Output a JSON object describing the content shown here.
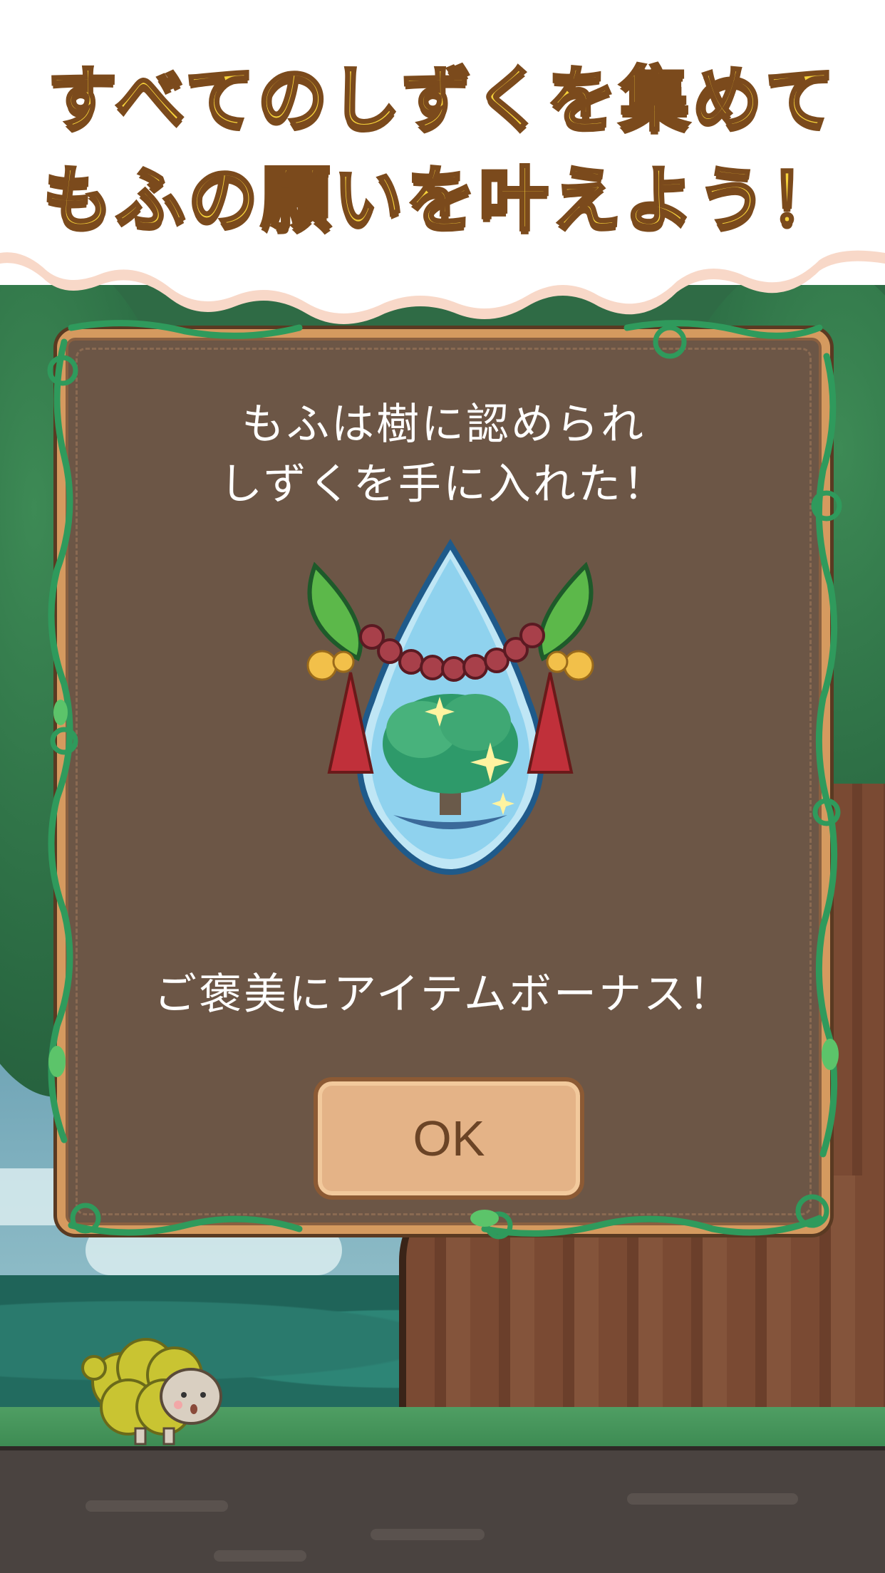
{
  "banner": {
    "line1": "すべてのしずくを集めて",
    "line2": "もふの願いを叶えよう！"
  },
  "dialog": {
    "message_line1": "もふは樹に認められ",
    "message_line2": "しずくを手に入れた！",
    "bonus_text": "ご褒美にアイテムボーナス！",
    "ok_label": "OK"
  },
  "colors": {
    "banner_text": "#f6d23a",
    "banner_outline": "#7b4a1c",
    "dialog_bg": "#6c5646",
    "dialog_border": "#d59a5f",
    "button_bg": "#e4b387"
  },
  "icons": {
    "reward": "tree-water-drop-icon",
    "character": "mofu-sheep-character"
  }
}
